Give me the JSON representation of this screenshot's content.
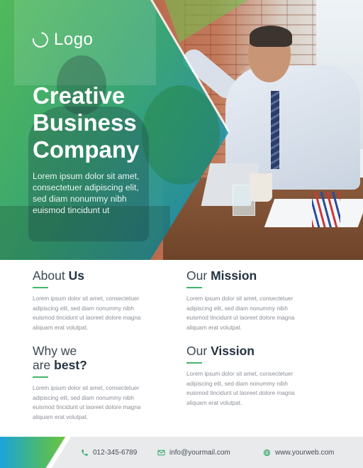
{
  "logo": {
    "text": "Logo"
  },
  "hero": {
    "title_lines": [
      "Creative",
      "Business",
      "Company"
    ],
    "desc_lines": [
      "Lorem ipsum dolor sit amet,",
      "consectetuer adipiscing elit,",
      "sed diam nonummy nibh",
      "euismod tincidunt ut"
    ]
  },
  "sections": {
    "about": {
      "light": "About",
      "bold": "Us",
      "body_lines": [
        "Lorem ipsum dolor sit amet, consectetuer",
        "adipiscing elit, sed diam nonummy nibh",
        "euismod tincidunt ut laoreet dolore magna",
        "aliquam erat volutpat."
      ]
    },
    "mission": {
      "light": "Our",
      "bold": "Mission",
      "body_lines": [
        "Lorem ipsum dolor sit amet, consectetuer",
        "adipiscing elit, sed diam nonummy nibh",
        "euismod tincidunt ut laoreet dolore magna",
        "aliquam erat volutpat."
      ]
    },
    "why": {
      "line1": "Why we",
      "line2_light": "are",
      "line2_bold": "best?",
      "body_lines": [
        "Lorem ipsum dolor sit amet, consectetuer",
        "adipiscing elit, sed diam nonummy nibh",
        "euismod tincidunt ut laoreet dolore magna",
        "aliquam erat volutpat."
      ]
    },
    "vision": {
      "light": "Our",
      "bold": "Vission",
      "body_lines": [
        "Lorem ipsum dolor sit amet, consectetuer",
        "adipiscing elit, sed diam nonummy nibh",
        "euismod tincidunt ut laoreet dolore magna",
        "aliquam erat volutpat."
      ]
    }
  },
  "footer": {
    "phone": "012-345-6789",
    "email": "info@yourmail.com",
    "web": "www.yourweb.com"
  },
  "colors": {
    "green": "#45b66a",
    "blue": "#1ba3d9",
    "heading": "#243240"
  }
}
